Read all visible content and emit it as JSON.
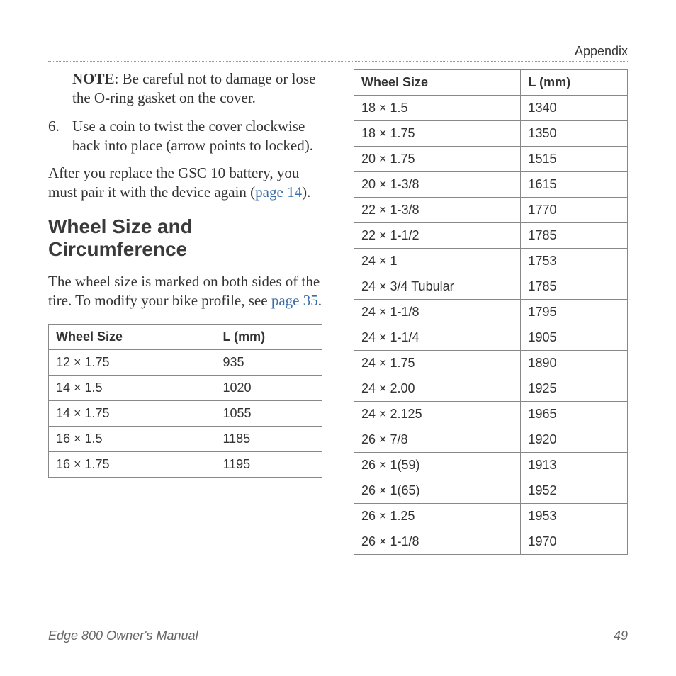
{
  "header": {
    "section": "Appendix"
  },
  "left": {
    "note_label": "NOTE",
    "note_text": ": Be careful not to damage or lose the O-ring gasket on the cover.",
    "list_number": "6.",
    "list_text": "Use a coin to twist the cover clockwise back into place (arrow points to locked).",
    "para_before": "After you replace the GSC 10 battery, you must pair it with the device again (",
    "para_link": "page 14",
    "para_after": ").",
    "heading": "Wheel Size and Circumference",
    "intro_before": "The wheel size is marked on both sides of the tire. To modify your bike profile, see ",
    "intro_link": "page 35",
    "intro_after": "."
  },
  "chart_data": [
    {
      "type": "table",
      "title": "Wheel Size and Circumference (left)",
      "headers": [
        "Wheel Size",
        "L (mm)"
      ],
      "rows": [
        [
          "12 × 1.75",
          "935"
        ],
        [
          "14 × 1.5",
          "1020"
        ],
        [
          "14 × 1.75",
          "1055"
        ],
        [
          "16 × 1.5",
          "1185"
        ],
        [
          "16 × 1.75",
          "1195"
        ]
      ]
    },
    {
      "type": "table",
      "title": "Wheel Size and Circumference (right)",
      "headers": [
        "Wheel Size",
        "L (mm)"
      ],
      "rows": [
        [
          "18 × 1.5",
          "1340"
        ],
        [
          "18 × 1.75",
          "1350"
        ],
        [
          "20 × 1.75",
          "1515"
        ],
        [
          "20 × 1-3/8",
          "1615"
        ],
        [
          "22 × 1-3/8",
          "1770"
        ],
        [
          "22 × 1-1/2",
          "1785"
        ],
        [
          "24 × 1",
          "1753"
        ],
        [
          "24 × 3/4 Tubular",
          "1785"
        ],
        [
          "24 × 1-1/8",
          "1795"
        ],
        [
          "24 × 1-1/4",
          "1905"
        ],
        [
          "24 × 1.75",
          "1890"
        ],
        [
          "24 × 2.00",
          "1925"
        ],
        [
          "24 × 2.125",
          "1965"
        ],
        [
          "26 × 7/8",
          "1920"
        ],
        [
          "26 × 1(59)",
          "1913"
        ],
        [
          "26 × 1(65)",
          "1952"
        ],
        [
          "26 × 1.25",
          "1953"
        ],
        [
          "26 × 1-1/8",
          "1970"
        ]
      ]
    }
  ],
  "footer": {
    "title": "Edge 800 Owner's Manual",
    "page": "49"
  }
}
